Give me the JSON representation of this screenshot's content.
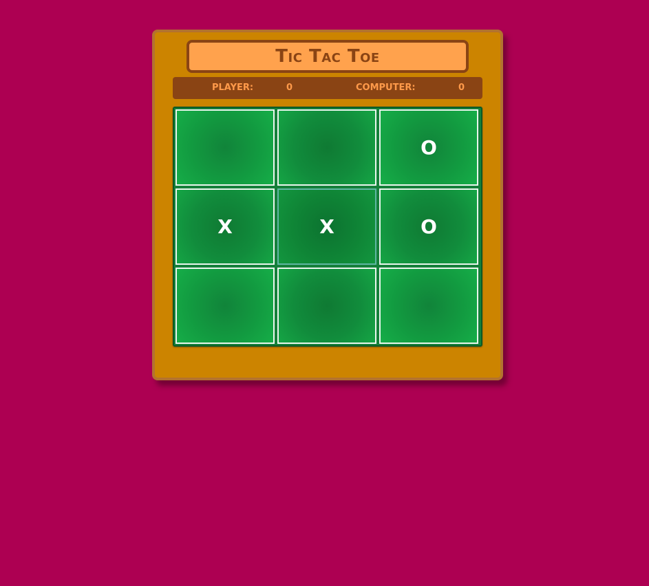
{
  "game": {
    "title": "Tic Tac Toe"
  },
  "scoreboard": {
    "player_label": "Player:",
    "player_score": "0",
    "computer_label": "Computer:",
    "computer_score": "0"
  },
  "board": {
    "cells": [
      "",
      "",
      "O",
      "X",
      "X",
      "O",
      "",
      "",
      ""
    ]
  },
  "colors": {
    "background": "#ad0052",
    "panel": "#cc8400",
    "title_bg": "#ffa24d",
    "title_text": "#8a4414",
    "score_bar": "#8a4414",
    "score_text": "#ff9a4a",
    "board_green": "#129a40",
    "mark": "#ffffff"
  }
}
